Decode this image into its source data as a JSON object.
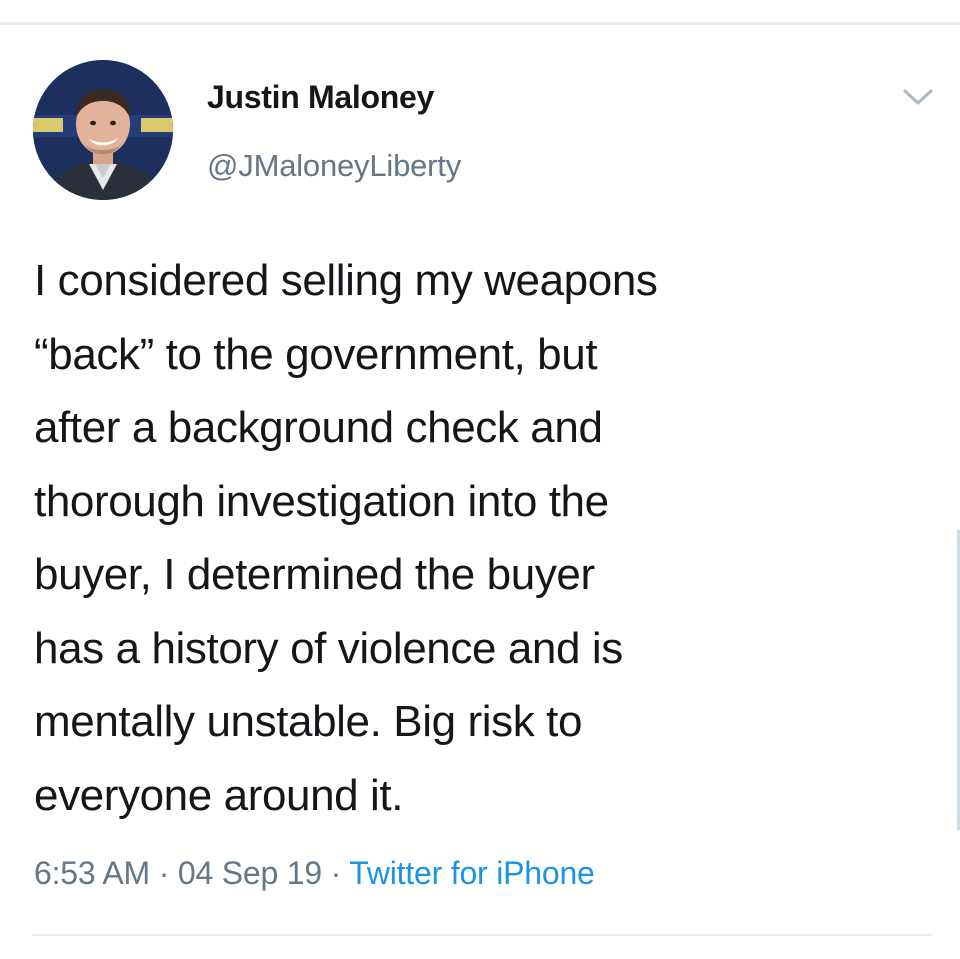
{
  "tweet": {
    "author": {
      "display_name": "Justin Maloney",
      "handle": "@JMaloneyLiberty",
      "avatar_icon": "profile-photo"
    },
    "menu_icon": "chevron-down-icon",
    "text_lines": [
      "I considered selling my weapons",
      "“back” to the government, but",
      "after a background check and",
      "thorough investigation into the",
      "buyer, I determined the buyer",
      "has a history of violence and is",
      "mentally unstable. Big risk to",
      "everyone around it."
    ],
    "meta": {
      "time": "6:53 AM",
      "separator": " · ",
      "date": "04 Sep 19",
      "source": "Twitter for iPhone"
    }
  },
  "colors": {
    "text": "#14171a",
    "secondary": "#657786",
    "link": "#1b95e0",
    "divider": "#e6ecf0"
  }
}
